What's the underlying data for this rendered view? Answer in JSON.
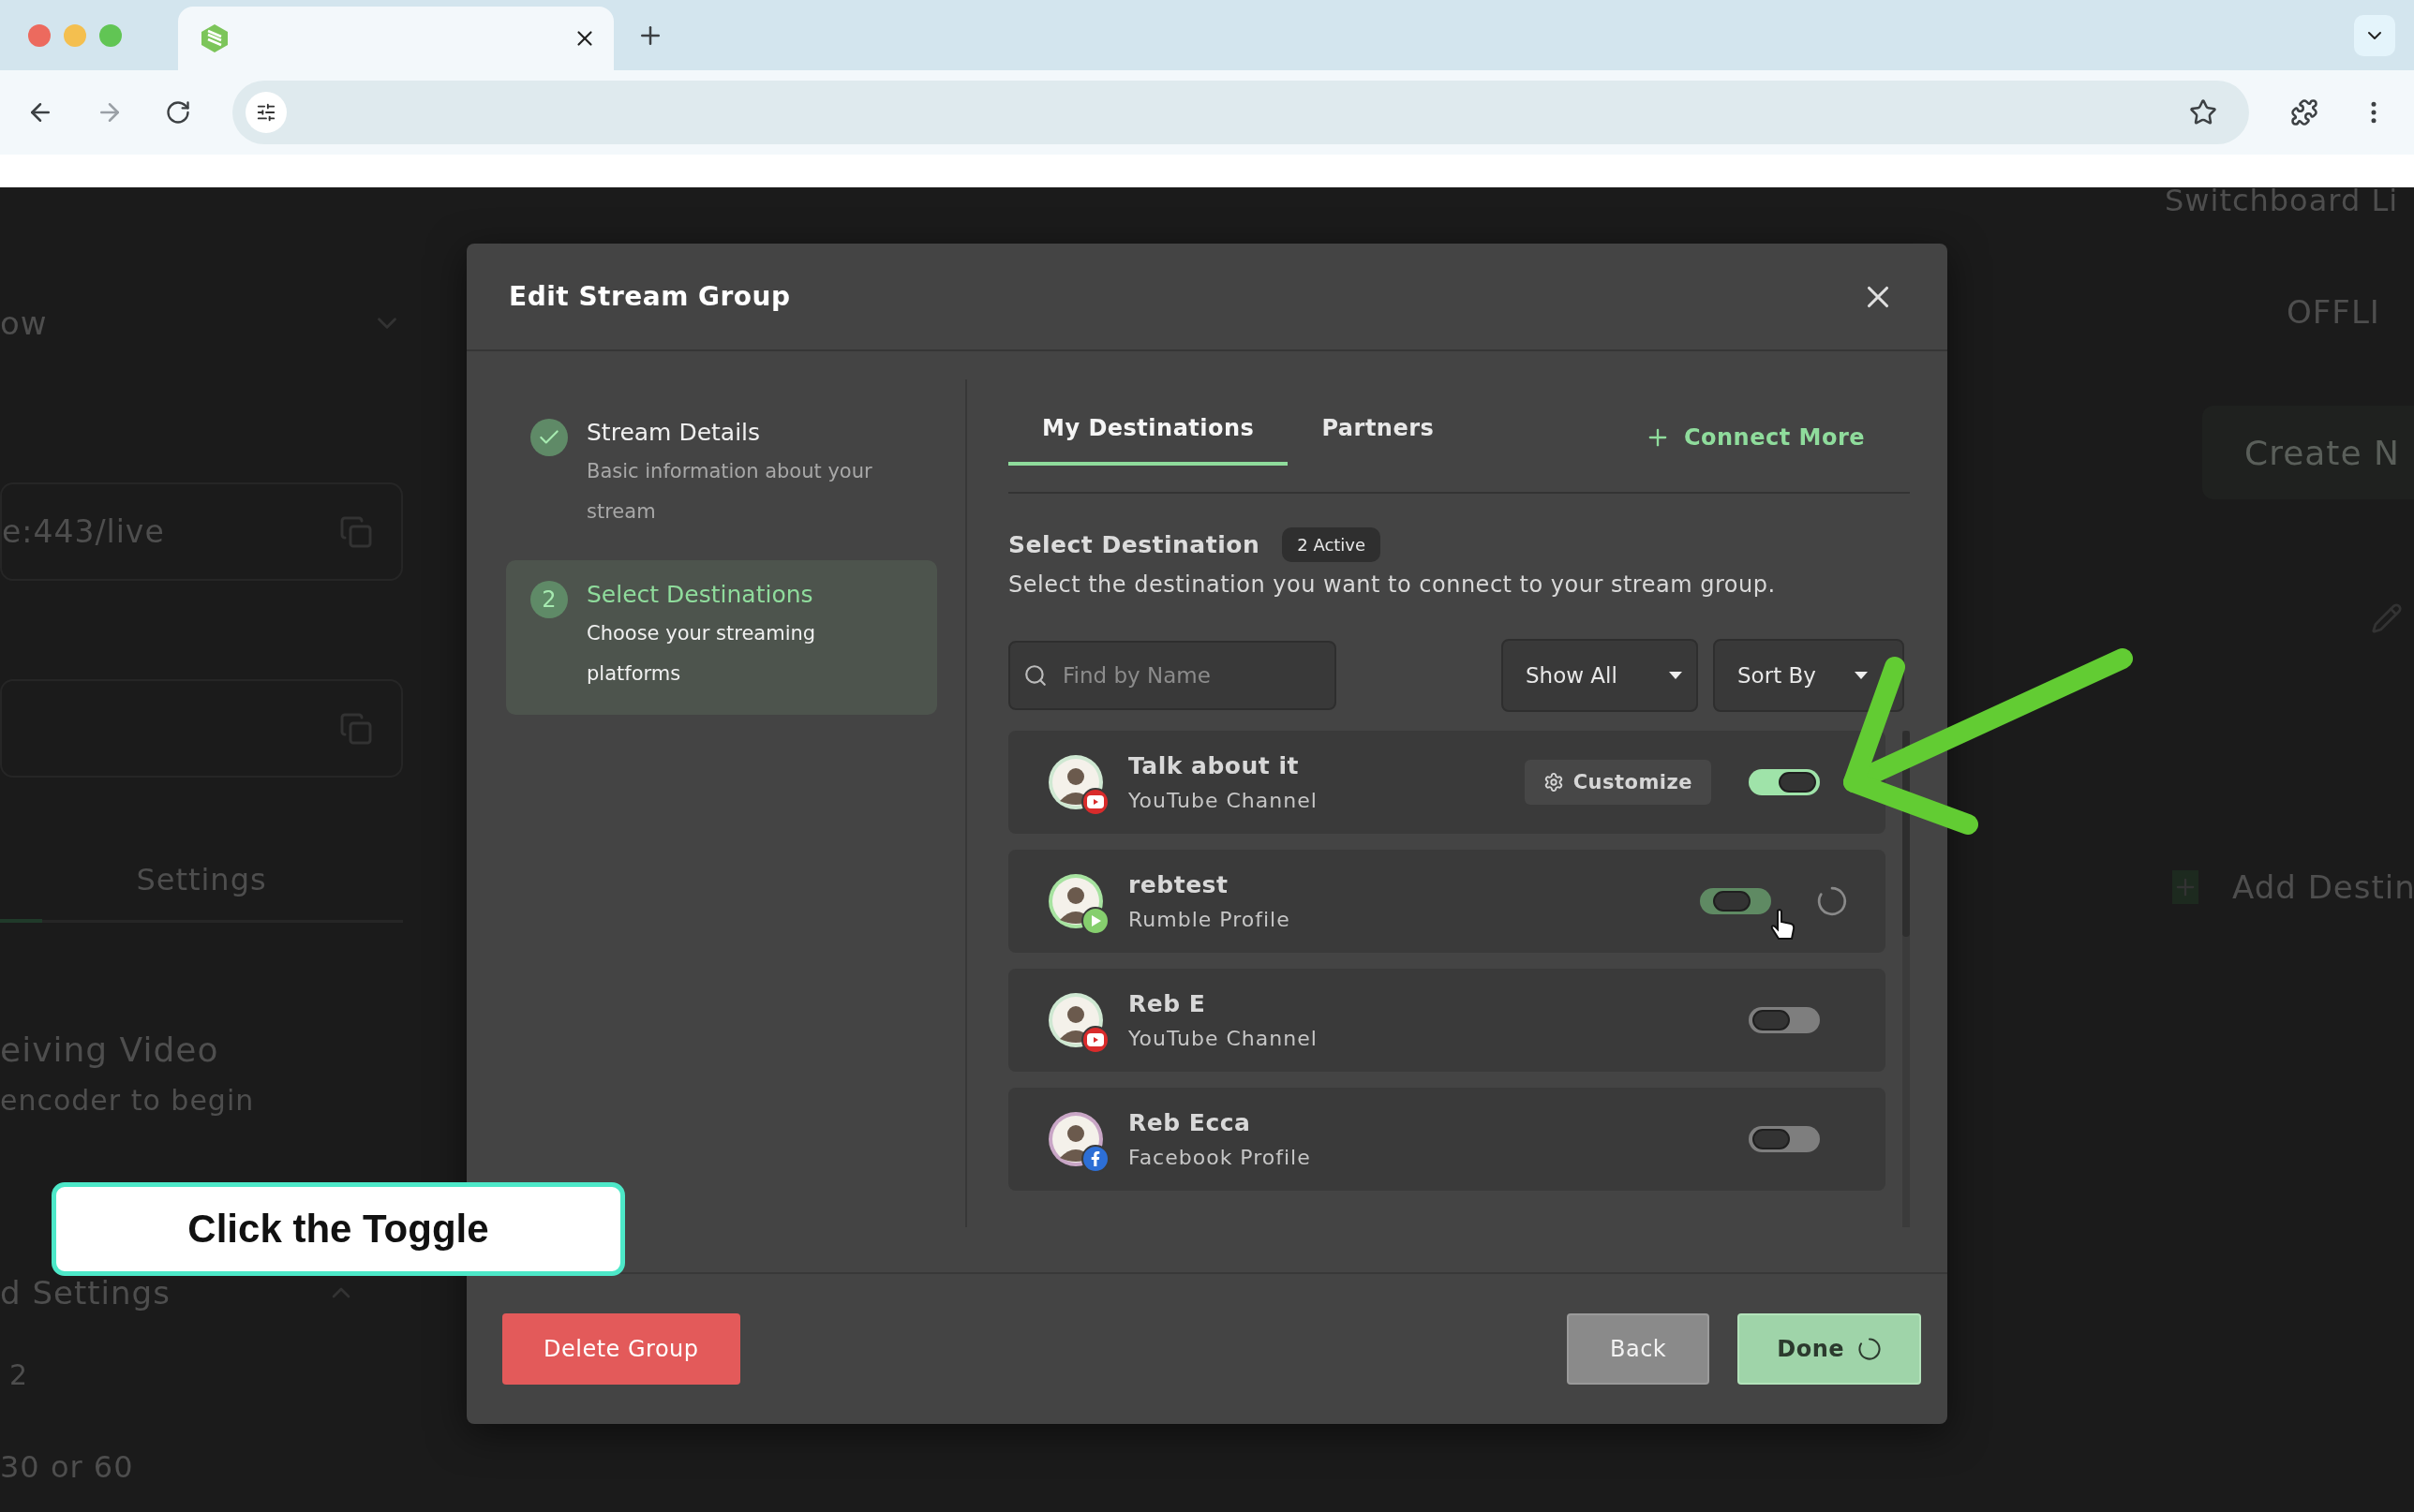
{
  "background_page": {
    "left": {
      "heading": "ow",
      "stream_url": "e:443/live",
      "tab": "Settings",
      "status_title": "eiving Video",
      "status_hint": "encoder to begin",
      "section": "d Settings",
      "value_1": "2",
      "value_2": "30 or 60"
    },
    "right": {
      "brand": "Switchboard Li",
      "status": "OFFLI",
      "create_button": "Create N",
      "add_destination": "Add Destin"
    }
  },
  "modal": {
    "title": "Edit Stream Group",
    "steps": [
      {
        "title": "Stream Details",
        "description": "Basic information about your stream",
        "completed": true,
        "selected": false
      },
      {
        "number": "2",
        "title": "Select Destinations",
        "description": "Choose your streaming platforms",
        "completed": false,
        "selected": true
      }
    ],
    "tabs": [
      {
        "label": "My Destinations",
        "selected": true
      },
      {
        "label": "Partners",
        "selected": false
      }
    ],
    "connect_more": "Connect More",
    "section_title": "Select Destination",
    "badge": "2 Active",
    "description": "Select the destination you want to connect to your stream group.",
    "search": {
      "placeholder": "Find by Name"
    },
    "filters": [
      "Show All",
      "Sort By"
    ],
    "destinations": [
      {
        "name": "Talk about it",
        "platform": "YouTube Channel",
        "kind": "youtube",
        "customize": "Customize",
        "on": true,
        "pending": false
      },
      {
        "name": "rebtest",
        "platform": "Rumble Profile",
        "kind": "rumble",
        "on": true,
        "pending": true
      },
      {
        "name": "Reb E",
        "platform": "YouTube Channel",
        "kind": "youtube",
        "on": false,
        "pending": false
      },
      {
        "name": "Reb Ecca",
        "platform": "Facebook Profile",
        "kind": "facebook",
        "on": false,
        "pending": false
      }
    ],
    "footer": {
      "delete": "Delete Group",
      "back": "Back",
      "done": "Done",
      "done_loading": true
    }
  },
  "callout": "Click the Toggle"
}
